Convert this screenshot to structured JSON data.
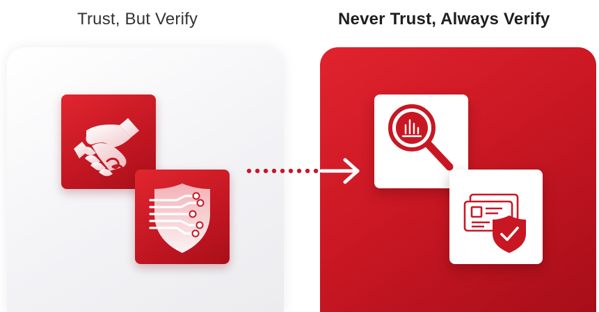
{
  "left": {
    "title": "Trust, But Verify",
    "icons": [
      "handshake-icon",
      "shield-circuit-icon"
    ]
  },
  "right": {
    "title": "Never Trust, Always Verify",
    "icons": [
      "magnifier-chart-icon",
      "id-card-shield-icon"
    ]
  },
  "colors": {
    "brand_red": "#c81723",
    "panel_light": "#f3f3f6",
    "white": "#ffffff"
  }
}
